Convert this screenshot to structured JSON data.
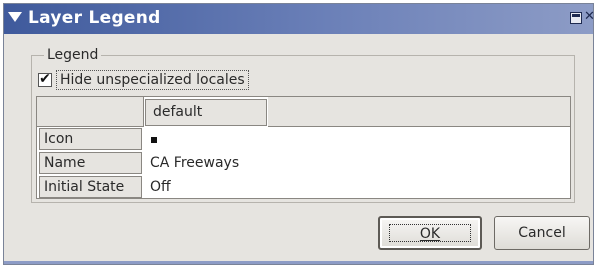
{
  "window": {
    "title": "Layer Legend"
  },
  "titlebar_icons": [
    "menu-arrow-icon",
    "maximize-icon",
    "close-icon"
  ],
  "legend": {
    "group_label": "Legend",
    "hide_unspecialized": {
      "label": "Hide unspecialized locales",
      "checked": true,
      "check_mark": "✔"
    },
    "table": {
      "column_header": "default",
      "rows": [
        {
          "header": "Icon",
          "value": ""
        },
        {
          "header": "Name",
          "value": "CA Freeways"
        },
        {
          "header": "Initial State",
          "value": "Off"
        }
      ]
    }
  },
  "buttons": {
    "ok": "OK",
    "cancel": "Cancel"
  },
  "colors": {
    "titlebar_start": "#3f5a9c",
    "titlebar_end": "#8d9cc6",
    "dialog_bg": "#e6e4e0"
  }
}
